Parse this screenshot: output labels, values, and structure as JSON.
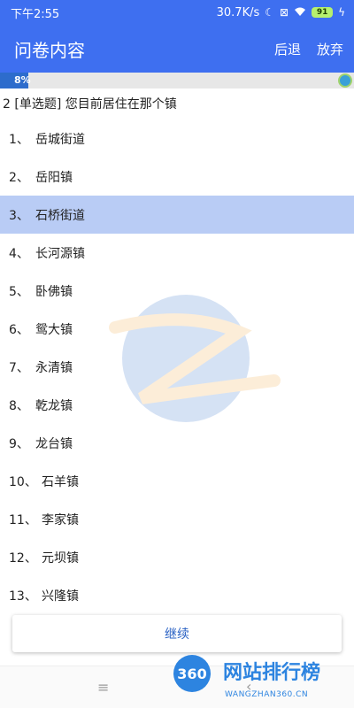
{
  "status_bar": {
    "time": "下午2:55",
    "net_speed": "30.7K/s",
    "battery": "91"
  },
  "app_bar": {
    "title": "问卷内容",
    "back_label": "后退",
    "abandon_label": "放弃"
  },
  "progress": {
    "label": "8%",
    "percent": 8
  },
  "question": {
    "text": "2 [单选题] 您目前居住在那个镇"
  },
  "options": [
    {
      "num": "1、",
      "label": "岳城街道"
    },
    {
      "num": "2、",
      "label": "岳阳镇"
    },
    {
      "num": "3、",
      "label": "石桥街道"
    },
    {
      "num": "4、",
      "label": "长河源镇"
    },
    {
      "num": "5、",
      "label": "卧佛镇"
    },
    {
      "num": "6、",
      "label": "鸳大镇"
    },
    {
      "num": "7、",
      "label": "永清镇"
    },
    {
      "num": "8、",
      "label": "乾龙镇"
    },
    {
      "num": "9、",
      "label": "龙台镇"
    },
    {
      "num": "10、",
      "label": "石羊镇"
    },
    {
      "num": "11、",
      "label": "李家镇"
    },
    {
      "num": "12、",
      "label": "元坝镇"
    },
    {
      "num": "13、",
      "label": "兴隆镇"
    }
  ],
  "selected_option": "石桥街道",
  "continue_label": "继续",
  "nav": {
    "menu_icon": "≡",
    "back_icon": "‹"
  },
  "watermark_badge": {
    "number": "360",
    "title": "网站排行榜",
    "subtitle": "WANGZHAN360.CN"
  },
  "colors": {
    "accent": "#3e6ff0",
    "selected_row": "#b9ccf5",
    "progress": "#2d6ccc"
  }
}
